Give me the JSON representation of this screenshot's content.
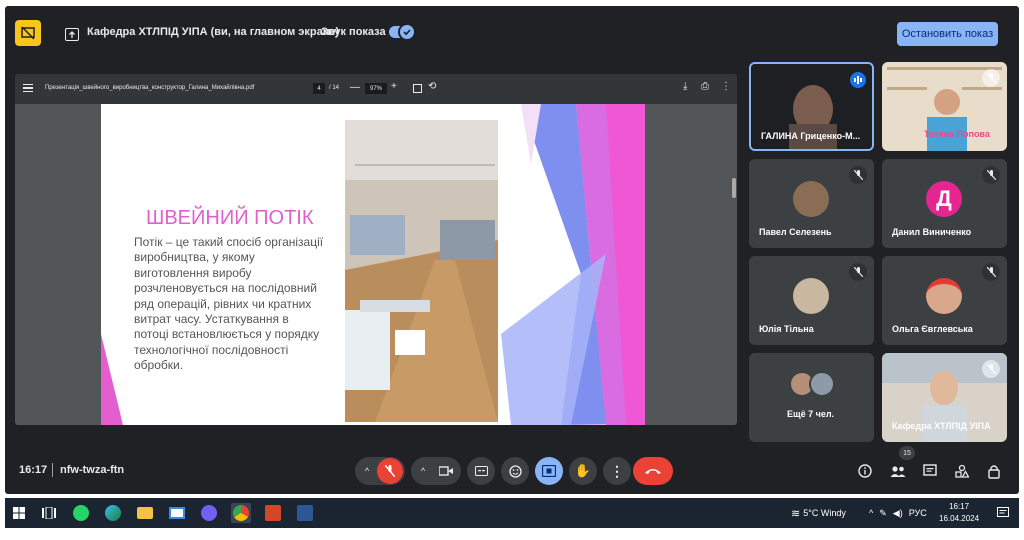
{
  "topbar": {
    "title": "Кафедра ХТЛПІД УІПА (ви, на главном экране)",
    "sound_label": "Звук показа",
    "sound_on": true,
    "stop_button": "Остановить показ"
  },
  "pdf": {
    "filename": "Презентація_швейного_виробництва_конструктор_Галина_Михайлівна.pdf",
    "page": "4",
    "total": "/ 14",
    "zoom": "97%",
    "minus": "—",
    "plus": "+"
  },
  "slide": {
    "title": "ШВЕЙНИЙ ПОТІК",
    "body": "Потік – це такий спосіб організації виробництва, у якому виготовлення виробу розчленовується на послідовний ряд операцій, рівних чи кратних витрат часу. Устаткування в потоці встановлюється у порядку технологічної послідовності обробки."
  },
  "participants": [
    {
      "name": "ГАЛИНА Гриценко-М...",
      "speaking": true
    },
    {
      "name": "Тетяна Попова",
      "muted": true
    },
    {
      "name": "Павел Селезень",
      "muted": true
    },
    {
      "name": "Данил Виниченко",
      "initial": "Д",
      "muted": true
    },
    {
      "name": "Юлія Тільна",
      "muted": true
    },
    {
      "name": "Ольга Євглевська",
      "muted": true
    },
    {
      "name": "Ещё 7 чел."
    },
    {
      "name": "Кафедра ХТЛПІД УІПА",
      "muted": true
    }
  ],
  "bottombar": {
    "time": "16:17",
    "code": "nfw-twza-ftn",
    "people_count": "15"
  },
  "taskbar": {
    "weather": "5°C Windy",
    "lang": "РУС",
    "time": "16:17",
    "date": "16.04.2024"
  },
  "colors": {
    "accent": "#8ab4f8",
    "danger": "#ea4335",
    "slide_title": "#e35fcf",
    "meet_bg": "#202124"
  }
}
